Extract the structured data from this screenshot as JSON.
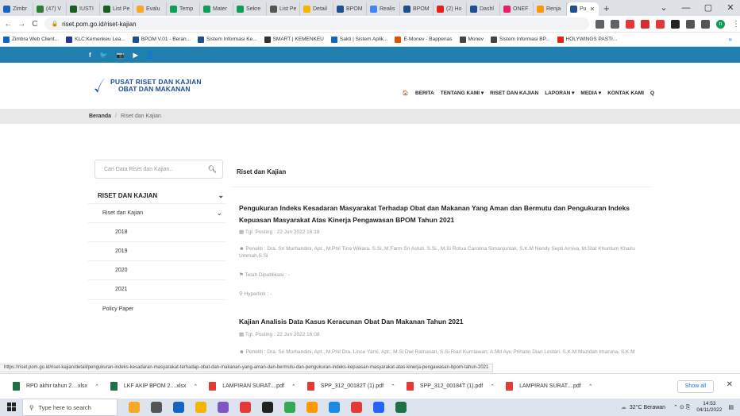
{
  "browser": {
    "tabs": [
      {
        "label": "Zimbr",
        "color": "#1565c0"
      },
      {
        "label": "(47) V",
        "color": "#2e7d32"
      },
      {
        "label": "IUSTI",
        "color": "#1b5e20"
      },
      {
        "label": "List Pe",
        "color": "#1b5e20"
      },
      {
        "label": "Evalu",
        "color": "#f9a825"
      },
      {
        "label": "Temp",
        "color": "#0f9d58"
      },
      {
        "label": "Mater",
        "color": "#0f9d58"
      },
      {
        "label": "Sekre",
        "color": "#0f9d58"
      },
      {
        "label": "List Pe",
        "color": "#555555"
      },
      {
        "label": "Detail",
        "color": "#f4b400"
      },
      {
        "label": "BPOM",
        "color": "#1d4f91"
      },
      {
        "label": "Realis",
        "color": "#4285f4"
      },
      {
        "label": "BPOM",
        "color": "#1d4f91"
      },
      {
        "label": "(2) Ho",
        "color": "#e62117"
      },
      {
        "label": "Dashl",
        "color": "#1d4f91"
      },
      {
        "label": "ONEF",
        "color": "#e91e63"
      },
      {
        "label": "Renja",
        "color": "#ff9800"
      },
      {
        "label": "Pu",
        "color": "#1d4f91",
        "active": true
      }
    ],
    "new_tab": "+",
    "window_controls": [
      "⌄",
      "—",
      "▢",
      "✕"
    ],
    "nav": {
      "back": "←",
      "forward": "→",
      "reload": "C"
    },
    "url": "riset.pom.go.id/riset-kajian",
    "extensions": [
      "#5f6368",
      "#5f6368",
      "#e53935",
      "#d32f2f",
      "#e53935",
      "#222222",
      "#555555",
      "#555555",
      "#0f9d58"
    ],
    "profile_initial": "n",
    "bookmarks": [
      {
        "label": "Zimbra Web Client...",
        "color": "#1565c0"
      },
      {
        "label": "KLC:Kemenkeu Lea...",
        "color": "#283593"
      },
      {
        "label": "BPOM V.01 - Beran...",
        "color": "#1d4f91"
      },
      {
        "label": "Sistem Informasi Ke...",
        "color": "#1d4f91"
      },
      {
        "label": "SMART | KEMENKEU",
        "color": "#333333"
      },
      {
        "label": "Sakti | Sistem Aplik...",
        "color": "#1565c0"
      },
      {
        "label": "E-Monev - Bappenas",
        "color": "#e65100"
      },
      {
        "label": "Monev",
        "color": "#444444"
      },
      {
        "label": "Sistem Informasi BP...",
        "color": "#444444"
      },
      {
        "label": "HOLYWINGS PASTI...",
        "color": "#e62117"
      }
    ],
    "bookmarks_more": "»"
  },
  "site": {
    "social": [
      "f",
      "🐦",
      "📷",
      "▶",
      "👤"
    ],
    "logo_line1": "PUSAT RISET DAN KAJIAN",
    "logo_line2": "OBAT DAN MAKANAN",
    "nav": [
      "🏠",
      "BERITA",
      "TENTANG KAMI ▾",
      "RISET DAN KAJIAN",
      "LAPORAN ▾",
      "MEDIA ▾",
      "KONTAK KAMI",
      "Q"
    ],
    "breadcrumb": {
      "home": "Beranda",
      "sep": "/",
      "current": "Riset dan Kajian"
    },
    "search_placeholder": "Cari Data Riset dan Kajian..",
    "sidebar_heading": "RISET DAN KAJIAN",
    "sidebar_items": [
      "Riset dan Kajian",
      "2018",
      "2019",
      "2020",
      "2021",
      "Policy Paper"
    ],
    "content_title": "Riset dan Kajian",
    "articles": [
      {
        "title": "Pengukuran Indeks Kesadaran Masyarakat Terhadap Obat dan Makanan Yang Aman dan Bermutu dan Pengukuran Indeks Kepuasan Masyarakat Atas Kinerja Pengawasan BPOM Tahun 2021",
        "posted": "Tgl. Posting : 22 Jun 2022 16:18",
        "researchers": "Peneliti : Dra. Sri Murhandini, Apt., M.Phil Tina Wikara, S.Si.,M.Farm Sri Astuti. S.Si., M.Si Rotua Carolina Simanjuntak, S.K.M Nendy Septi Arniva, M.Stat Khuntum Khairu Ummah,S.Si",
        "published": "Telah Dipublikasi : -",
        "hyperlink": "Hyperlink : -"
      },
      {
        "title": "Kajian Analisis Data Kasus Keracunan Obat Dan Makanan Tahun 2021",
        "posted": "Tgl. Posting : 22 Jun 2022 16:08",
        "researchers": "Peneliti : Dra. Sri Murhandini, Apt., M.Phil Dra. Lince Yarni, Apt., M.Si Dwi Ratnasari, S.Si Rian Kurniawan, A.Md Ayu Prihatin Dian Lestari, S.K.M Mazidah Imaruna, S.K.M"
      }
    ]
  },
  "status_url": "https://riset.pom.go.id/riset-kajian/detail/pengukuran-indeks-kesadaran-masyarakat-terhadap-obat-dan-makanan-yang-aman-dan-bermutu-dan-pengukuran-indeks-kepuasan-masyarakat-atas-kinerja-pengawasan-bpom-tahun-2021",
  "downloads": [
    {
      "label": "RPD akhir tahun 2....xlsx",
      "type": "xlsx",
      "color": "#1e7145"
    },
    {
      "label": "LKF AKIP BPOM 2....xlsx",
      "type": "xlsx",
      "color": "#1e7145"
    },
    {
      "label": "LAMPIRAN SURAT....pdf",
      "type": "pdf",
      "color": "#e53935"
    },
    {
      "label": "SPP_312_00182T (1).pdf",
      "type": "pdf",
      "color": "#e53935"
    },
    {
      "label": "SPP_312_00184T (1).pdf",
      "type": "pdf",
      "color": "#e53935"
    },
    {
      "label": "LAMPIRAN SURAT....pdf",
      "type": "pdf",
      "color": "#e53935"
    }
  ],
  "downloads_show_all": "Show all",
  "taskbar": {
    "search_placeholder": "Type here to search",
    "apps": [
      "#f9a825",
      "#555555",
      "#1565c0",
      "#f4b400",
      "#7e57c2",
      "#e53935",
      "#222222",
      "#34a853",
      "#ff9800",
      "#1e88e5",
      "#e53935",
      "#2962ff",
      "#1e7145"
    ],
    "weather": "32°C Berawan",
    "time": "14:53",
    "date": "04/11/2022"
  }
}
